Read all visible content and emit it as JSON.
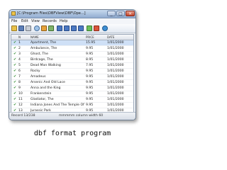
{
  "window": {
    "title": "[C:\\Program Files\\DBFView\\DBF\\Ope...]",
    "min_label": "_",
    "max_label": "□",
    "close_label": "×"
  },
  "menu": [
    "File",
    "Edit",
    "View",
    "Records",
    "Help"
  ],
  "toolbar_icons": [
    "open-icon",
    "save-icon",
    "print-icon",
    "find-icon",
    "filter-icon",
    "sort-icon",
    "first-icon",
    "prev-icon",
    "next-icon",
    "last-icon",
    "add-icon",
    "delete-icon",
    "info-icon"
  ],
  "columns": [
    "",
    "N",
    "NAME",
    "PRICE",
    "DATE"
  ],
  "rows": [
    {
      "n": "1",
      "name": "Apartment, The",
      "price": "15.95",
      "date": "1/01/2000"
    },
    {
      "n": "2",
      "name": "Ambulance, The",
      "price": "9.95",
      "date": "1/01/2000"
    },
    {
      "n": "3",
      "name": "Ghost, The",
      "price": "9.95",
      "date": "1/01/2000"
    },
    {
      "n": "4",
      "name": "Birdcage, The",
      "price": "8.95",
      "date": "1/01/2000"
    },
    {
      "n": "5",
      "name": "Dead Man Walking",
      "price": "7.95",
      "date": "1/01/2000"
    },
    {
      "n": "6",
      "name": "Rocky",
      "price": "9.95",
      "date": "1/01/2000"
    },
    {
      "n": "7",
      "name": "Amadeus",
      "price": "9.95",
      "date": "1/01/2000"
    },
    {
      "n": "8",
      "name": "Arsenic And Old Lace",
      "price": "9.95",
      "date": "1/01/2000"
    },
    {
      "n": "9",
      "name": "Anna and the King",
      "price": "9.95",
      "date": "1/01/2000"
    },
    {
      "n": "10",
      "name": "Frankenstein",
      "price": "9.95",
      "date": "1/01/2000"
    },
    {
      "n": "11",
      "name": "Gladiator, The",
      "price": "9.95",
      "date": "1/01/2000"
    },
    {
      "n": "12",
      "name": "Indiana Jones And The Temple Of Doom",
      "price": "9.95",
      "date": "1/01/2000"
    },
    {
      "n": "13",
      "name": "Jurassic Park",
      "price": "9.95",
      "date": "1/01/2000"
    }
  ],
  "status": {
    "records": "Record 13/238",
    "info": "mmmmm column width 60"
  },
  "caption": "dbf format program",
  "colors": {
    "titlebar": "#a9c0de",
    "selection": "#cfe0f6",
    "check": "#2d8a2d"
  }
}
